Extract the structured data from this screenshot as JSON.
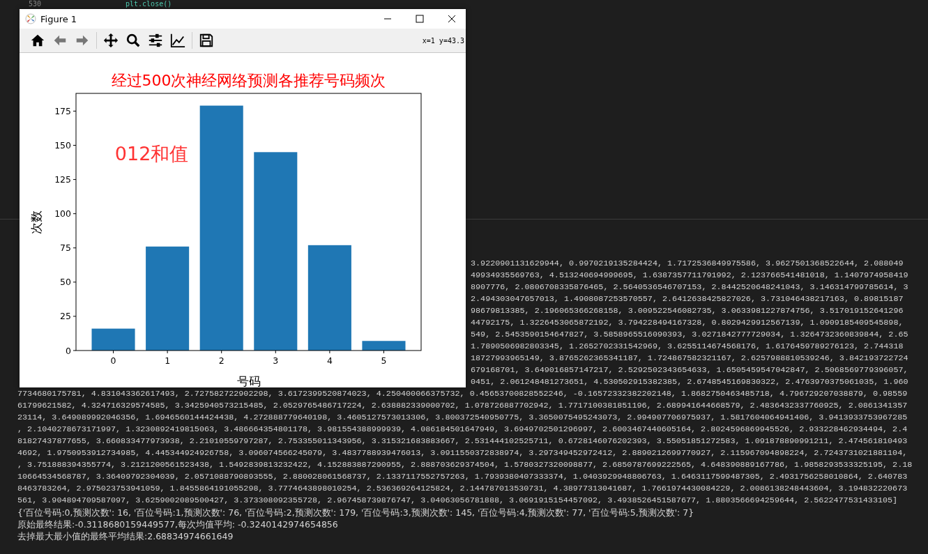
{
  "editor": {
    "line_number": "530",
    "code": "plt.close()"
  },
  "figure": {
    "title": "Figure 1",
    "coordinates": "x=1 y=43.3",
    "chart_data": {
      "type": "bar",
      "title": "经过500次神经网络预测各推荐号码频次",
      "xlabel": "号码",
      "ylabel": "次数",
      "categories": [
        "0",
        "1",
        "2",
        "3",
        "4",
        "5"
      ],
      "values": [
        16,
        76,
        179,
        145,
        77,
        7
      ],
      "ylim": [
        0,
        187.95
      ],
      "yticks": [
        0,
        25,
        50,
        75,
        100,
        125,
        150,
        175
      ],
      "annotations": [
        "012和值"
      ]
    }
  },
  "console": [
    {
      "kind": "partial",
      "text": "3.9220901131629944, 0.9970219135284424, 1.7172536849975586, 3.9627501368522644, 2.088049"
    },
    {
      "kind": "partial",
      "text": "49934935569763, 4.513240694999695, 1.6387357711791992, 2.123766541481018, 1.1407974958419"
    },
    {
      "kind": "partial",
      "text": "8907776, 2.0806708335876465, 2.5640536546707153, 2.8442520648241043, 3.146314799785614, 3"
    },
    {
      "kind": "partial",
      "text": "2.494303047657013, 1.4908087253570557, 2.6412638425827026, 3.731046438217163, 0.89815187"
    },
    {
      "kind": "partial",
      "text": "98679813385, 2.196065366268158, 3.009522546082735, 3.0633981227874756, 3.517019152641296"
    },
    {
      "kind": "partial",
      "text": "44792175, 1.3226453065872192, 3.794228494167328, 0.8029429912567139, 1.0909185409545898,"
    },
    {
      "kind": "partial",
      "text": "549, 2.5453590154647827, 3.5858965516090393, 3.0271842777729034, 1.3264732360839844, 2.65"
    },
    {
      "kind": "partial",
      "text": "1.7890506982803345, 1.2652702331542969, 3.6255114674568176, 1.6176459789276123, 2.744318"
    },
    {
      "kind": "partial",
      "text": "18727993965149, 3.8765262365341187, 1.724867582321167, 2.6257988810539246, 3.842193722724"
    },
    {
      "kind": "partial",
      "text": "679168701, 3.649016857147217, 2.5292502343654633, 1.6505459547042847, 2.5068569779396057,"
    },
    {
      "kind": "partial",
      "text": "0451, 2.061248481273651, 4.530502915382385, 2.6748545169830322, 2.4763970375061035, 1.960"
    },
    {
      "kind": "full",
      "text": "7734680175781, 4.831043362617493, 2.727582722902298, 3.6172399520874023, 4.250400066375732, 0.45653700828552246, -0.16572332382202148, 1.8682750463485718, 4.796729207038879, 0.98559"
    },
    {
      "kind": "full",
      "text": "61799621582, 4.324716329574585, 3.3425940573215485, 2.0529765486717224, 2.638882339000702, 1.078726887702942, 1.7717100381851196, 2.689941644668579, 2.4836432337760925, 2.0861341357"
    },
    {
      "kind": "full",
      "text": "23114, 3.649089992046356, 1.6946560144424438, 4.272888779640198, 3.4605127573013306, 3.800372540950775, 3.3650075495243073, 2.994907706975937, 1.5817604064941406, 3.9413933753967285"
    },
    {
      "kind": "full",
      "text": ", 2.1040278673171997, 1.3230892419815063, 3.486664354801178, 3.981554388999939, 4.086184501647949, 3.6949702501296997, 2.6003467440605164, 2.8024596869945526, 2.933228462934494, 2.4"
    },
    {
      "kind": "full",
      "text": "81827437877655, 3.660833477973938, 2.21010559797287, 2.753355011343956, 3.315321683883667, 2.531444102525711, 0.6728146076202393, 3.55051851272583, 1.091878890991211, 2.474561810493"
    },
    {
      "kind": "full",
      "text": "4692, 1.9750953912734985, 4.445344924926758, 3.096074566245079, 3.4837788939476013, 3.0911550372838974, 3.297349452972412, 2.8890212699770927, 2.115967094898224, 2.7243731021881104,"
    },
    {
      "kind": "full",
      "text": ", 3.751888394355774, 3.2121200561523438, 1.5492839813232422, 4.152883887290955, 2.888703629374504, 1.5780327320098877, 2.6850787699222565, 4.648390889167786, 1.9858293533325195, 2.18"
    },
    {
      "kind": "full",
      "text": "10664534568787, 3.36409792304039, 2.0571088790893555, 2.880028061568737, 2.1337117552757263, 1.7939380407333374, 1.0403929948806763, 1.6463117599487305, 2.4931756258010864, 2.640783"
    },
    {
      "kind": "full",
      "text": "8463783264, 2.975023753941059, 1.8455864191055298, 3.7774643898010254, 2.536369264125824, 2.144787013530731, 4.38977313041687, 1.7661974430084229, 2.0086138248443604, 3.194832220673"
    },
    {
      "kind": "full",
      "text": "561, 3.904894709587097, 3.6259002089500427, 3.373308092355728, 2.967458739876747, 3.04063056781888, 3.0691915154457092, 3.4938526451587677, 1.8803566694259644, 2.5622477531433105]"
    },
    {
      "kind": "result",
      "text": "{'百位号码:0,预测次数': 16, '百位号码:1,预测次数': 76, '百位号码:2,预测次数': 179, '百位号码:3,预测次数': 145, '百位号码:4,预测次数': 77, '百位号码:5,预测次数': 7}"
    },
    {
      "kind": "result",
      "text": "原始最终结果:-0.3118680159449577,每次均值平均: -0.3240142974654856"
    },
    {
      "kind": "result",
      "text": "去掉最大最小值的最终平均结果:2.68834974661649"
    }
  ]
}
